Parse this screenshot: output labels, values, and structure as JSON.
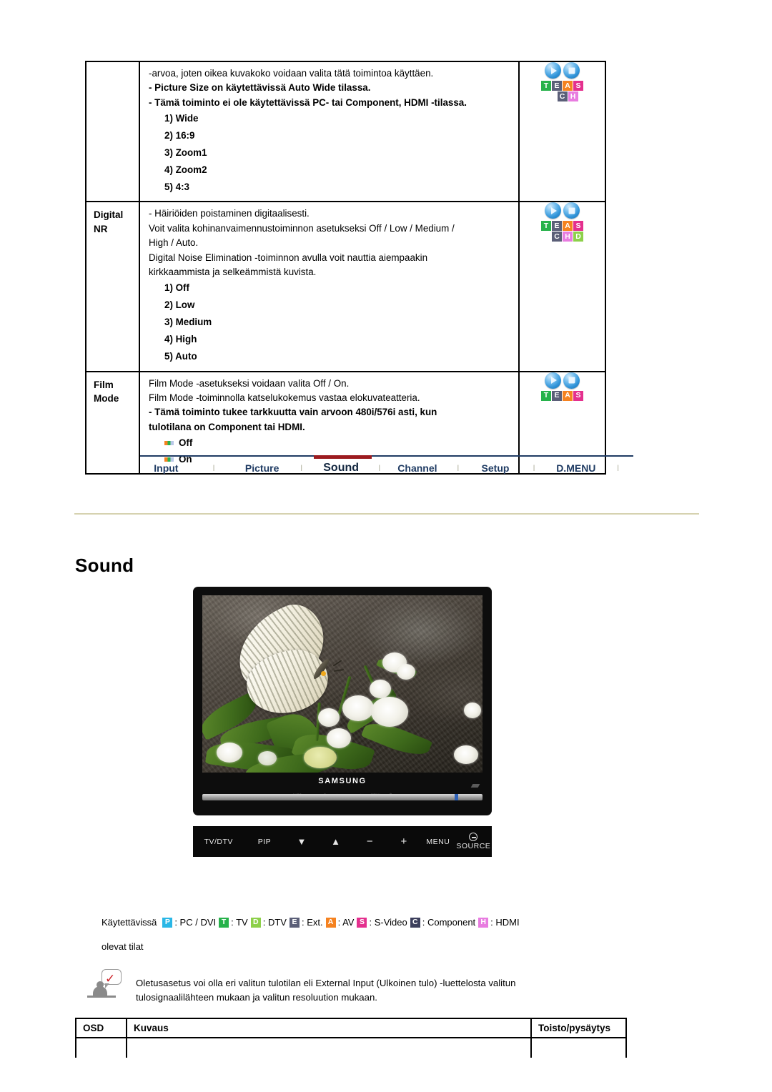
{
  "spec_table": {
    "rows": [
      {
        "osd": "",
        "desc_lines": [
          {
            "text": "-arvoa, joten oikea kuvakoko voidaan valita tätä toimintoa käyttäen.",
            "bold": false
          },
          {
            "text": "- Picture Size on käytettävissä Auto Wide tilassa.",
            "bold": true
          },
          {
            "text": "- Tämä toiminto ei ole käytettävissä PC- tai Component, HDMI -tilassa.",
            "bold": true
          }
        ],
        "options": [
          "1) Wide",
          "2) 16:9",
          "3) Zoom1",
          "4) Zoom2",
          "5) 4:3"
        ],
        "option_style": "numbered",
        "icon_letters_row1": [
          "T",
          "E",
          "A",
          "S"
        ],
        "icon_letters_row2": [
          "C",
          "H"
        ],
        "row2_offset": 1
      },
      {
        "osd": "Digital\nNR",
        "osd_line1": "Digital",
        "osd_line2": "NR",
        "desc_lines": [
          {
            "text": "- Häiriöiden poistaminen digitaalisesti.",
            "bold": false
          },
          {
            "text": "Voit valita kohinanvaimennustoiminnon asetukseksi Off / Low / Medium /",
            "bold": false
          },
          {
            "text": "High / Auto.",
            "bold": false
          },
          {
            "text": "Digital Noise Elimination -toiminnon avulla voit nauttia aiempaakin",
            "bold": false
          },
          {
            "text": "kirkkaammista ja selkeämmistä kuvista.",
            "bold": false
          }
        ],
        "options": [
          "1) Off",
          "2) Low",
          "3) Medium",
          "4) High",
          "5) Auto"
        ],
        "option_style": "numbered",
        "icon_letters_row1": [
          "T",
          "E",
          "A",
          "S"
        ],
        "icon_letters_row2": [
          "C",
          "H",
          "D"
        ],
        "row2_offset": 1
      },
      {
        "osd_line1": "Film",
        "osd_line2": "Mode",
        "desc_lines": [
          {
            "text": "Film Mode -asetukseksi voidaan valita Off / On.",
            "bold": false
          },
          {
            "text": "Film Mode -toiminnolla katselukokemus vastaa elokuvateatteria.",
            "bold": false
          },
          {
            "text": "- Tämä toiminto tukee tarkkuutta vain arvoon 480i/576i asti, kun",
            "bold": true
          },
          {
            "text": "tulotilana on Component tai HDMI.",
            "bold": true
          }
        ],
        "options": [
          "Off",
          "On"
        ],
        "option_style": "bulleted",
        "icon_letters_row1": [
          "T",
          "E",
          "A",
          "S"
        ],
        "icon_letters_row2": [],
        "row2_offset": 0
      }
    ]
  },
  "nav": {
    "items": [
      {
        "label": "Input",
        "active": false
      },
      {
        "label": "Picture",
        "active": false
      },
      {
        "label": "Sound",
        "active": true
      },
      {
        "label": "Channel",
        "active": false
      },
      {
        "label": "Setup",
        "active": false
      },
      {
        "label": "D.MENU",
        "active": false
      }
    ],
    "separator": "I",
    "active_color": "#9c1b1f",
    "text_color": "#1f3b63"
  },
  "page_heading": "Sound",
  "monitor": {
    "brand": "SAMSUNG",
    "micro_buttons": [
      "AUTO",
      "▬",
      "▼",
      "▲",
      "–",
      "+",
      "MENU",
      "⏻"
    ],
    "controls": [
      {
        "label": "TV/DTV",
        "icon": "tv-dtv"
      },
      {
        "label": "PIP",
        "icon": "pip"
      },
      {
        "label": "▼",
        "icon": "arrow-down"
      },
      {
        "label": "▲",
        "icon": "arrow-up"
      },
      {
        "label": "−",
        "icon": "minus"
      },
      {
        "label": "+",
        "icon": "plus"
      },
      {
        "label": "MENU",
        "icon": "menu"
      },
      {
        "label": "SOURCE",
        "icon": "source"
      }
    ]
  },
  "legend": {
    "prefix": "Käytettävissä",
    "entries": [
      {
        "chip": "P",
        "text": ": PC / DVI",
        "color": "#2ab7e6"
      },
      {
        "chip": "T",
        "text": ": TV",
        "color": "#27b24b"
      },
      {
        "chip": "D",
        "text": ": DTV",
        "color": "#8dd04a"
      },
      {
        "chip": "E",
        "text": ": Ext.",
        "color": "#5b5f78"
      },
      {
        "chip": "A",
        "text": ": AV",
        "color": "#f58220"
      },
      {
        "chip": "S",
        "text": ": S-Video",
        "color": "#e4308e"
      },
      {
        "chip": "C",
        "text": ": Component",
        "color": "#3c3f5c"
      },
      {
        "chip": "H",
        "text": ": HDMI",
        "color": "#e87ce0"
      }
    ],
    "suffix": "olevat tilat"
  },
  "note": {
    "line1": "Oletusasetus voi olla eri valitun tulotilan eli External Input (Ulkoinen tulo) -luettelosta valitun",
    "line2": "tulosignaalilähteen mukaan ja valitun resoluution mukaan."
  },
  "bottom_table": {
    "headers": [
      "OSD",
      "Kuvaus",
      "Toisto/pysäytys"
    ]
  }
}
